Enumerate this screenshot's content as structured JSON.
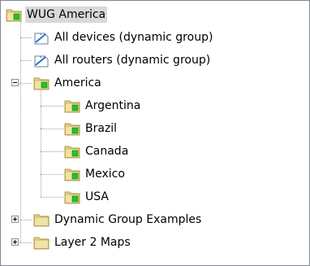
{
  "tree": {
    "root": {
      "label": "WUG America",
      "icon": "folder-green-icon",
      "selected": true
    },
    "items": [
      {
        "label": "All devices (dynamic group)",
        "icon": "dynamic-group-icon"
      },
      {
        "label": "All routers (dynamic group)",
        "icon": "dynamic-group-icon"
      },
      {
        "label": "America",
        "icon": "folder-green-icon",
        "expanded": true,
        "children": [
          {
            "label": "Argentina",
            "icon": "folder-green-icon"
          },
          {
            "label": "Brazil",
            "icon": "folder-green-icon"
          },
          {
            "label": "Canada",
            "icon": "folder-green-icon"
          },
          {
            "label": "Mexico",
            "icon": "folder-green-icon"
          },
          {
            "label": "USA",
            "icon": "folder-green-icon"
          }
        ]
      },
      {
        "label": "Dynamic Group Examples",
        "icon": "folder-icon",
        "expanded": false
      },
      {
        "label": "Layer 2 Maps",
        "icon": "folder-icon",
        "expanded": false
      }
    ]
  },
  "colors": {
    "folder": "#e8d487",
    "folder_dark": "#c9b060",
    "status_green": "#2ecc2e",
    "selection": "#d9d9d9"
  }
}
